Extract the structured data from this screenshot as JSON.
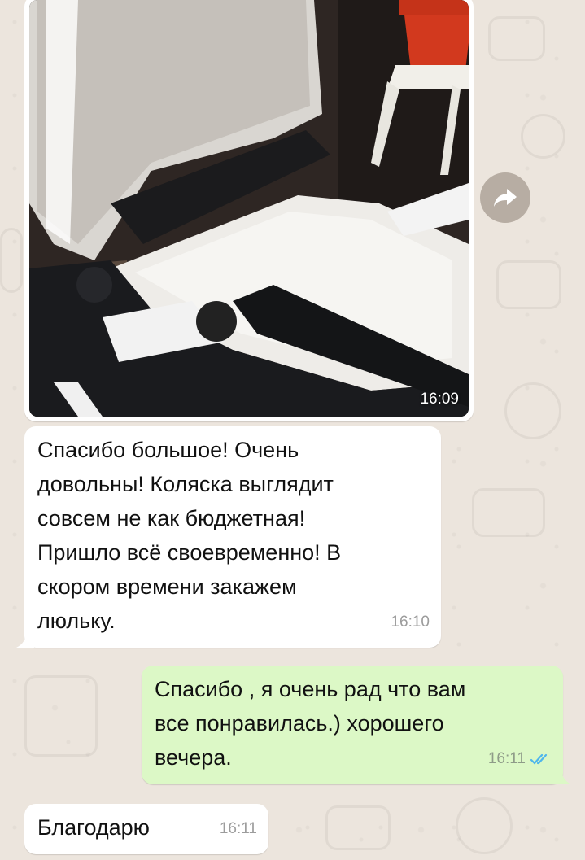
{
  "chat": {
    "messages": [
      {
        "type": "image",
        "direction": "incoming",
        "time": "16:09",
        "image_description": "photo of a white and black baby stroller bassinet"
      },
      {
        "type": "text",
        "direction": "incoming",
        "text": "Спасибо большое! Очень\nдовольны! Коляска выглядит\nсовсем не как бюджетная!\nПришло всё своевременно! В\nскором времени закажем\nлюльку.",
        "time": "16:10"
      },
      {
        "type": "text",
        "direction": "outgoing",
        "text": "Спасибо , я очень рад что вам\nвсе понравилась.) хорошего\nвечера.",
        "time": "16:11",
        "status": "read",
        "status_icon": "double-check-icon"
      },
      {
        "type": "text",
        "direction": "incoming",
        "text": "Благодарю",
        "time": "16:11"
      }
    ],
    "forward_icon": "forward-icon"
  },
  "colors": {
    "incoming_bubble": "#ffffff",
    "outgoing_bubble": "#dcf8c6",
    "read_ticks": "#4fb6ec",
    "wallpaper": "#ece5dd"
  }
}
